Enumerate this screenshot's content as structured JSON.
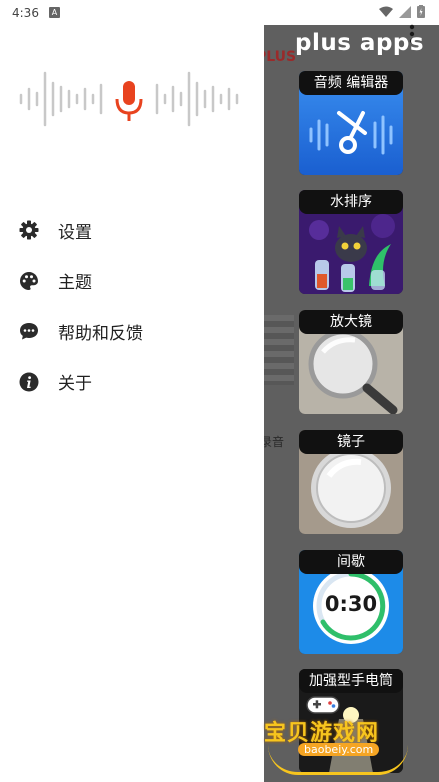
{
  "status_bar": {
    "time": "4:36",
    "notification_icon": "A"
  },
  "drawer": {
    "banner_icon": "microphone-waveform-icon",
    "menu": [
      {
        "label": "设置",
        "icon": "gear-icon"
      },
      {
        "label": "主题",
        "icon": "palette-icon"
      },
      {
        "label": "帮助和反馈",
        "icon": "feedback-icon"
      },
      {
        "label": "关于",
        "icon": "info-icon"
      }
    ]
  },
  "behind": {
    "logo_peek": "PLUS",
    "label_peek": "录音"
  },
  "plus_apps": {
    "title": "plus apps",
    "apps": [
      {
        "label": "音频 编辑器"
      },
      {
        "label": "水排序"
      },
      {
        "label": "放大镜"
      },
      {
        "label": "镜子"
      },
      {
        "label": "间歇",
        "timer_text": "0:30"
      },
      {
        "label": "加强型手电筒"
      }
    ]
  },
  "watermark": {
    "text": "宝贝游戏网",
    "url": "baobeiy.com"
  },
  "colors": {
    "accent_mic": "#e8431f",
    "wave_gray": "#c8c8c8",
    "scrim": "#5f5f5f"
  }
}
